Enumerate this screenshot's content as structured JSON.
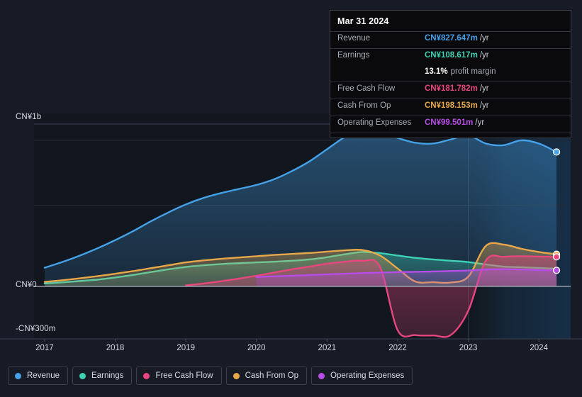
{
  "theme": {
    "background": "#161b26",
    "plot_background": "#12171f",
    "forecast_background": "#16283a",
    "gridline": "#252b36",
    "zero_line": "#aab2bd",
    "axis_text": "#d6dae2",
    "tooltip_bg": "#0a0a0c",
    "tooltip_border": "#3a3f4a"
  },
  "tooltip": {
    "date": "Mar 31 2024",
    "rows": [
      {
        "label": "Revenue",
        "value": "CN¥827.647m",
        "unit": "/yr",
        "color": "#45a1e8"
      },
      {
        "label": "Earnings",
        "value": "CN¥108.617m",
        "unit": "/yr",
        "color": "#3ed2b5"
      },
      {
        "label": "Free Cash Flow",
        "value": "CN¥181.782m",
        "unit": "/yr",
        "color": "#e8467e"
      },
      {
        "label": "Cash From Op",
        "value": "CN¥198.153m",
        "unit": "/yr",
        "color": "#e8a849"
      },
      {
        "label": "Operating Expenses",
        "value": "CN¥99.501m",
        "unit": "/yr",
        "color": "#b84ce8"
      }
    ],
    "margin": {
      "value": "13.1%",
      "text": "profit margin"
    }
  },
  "axes": {
    "y_labels": {
      "top": "CN¥1b",
      "zero": "CN¥0",
      "bottom": "-CN¥300m"
    },
    "y_ticks_values": [
      1000,
      0,
      -300
    ],
    "x_labels": [
      "2017",
      "2018",
      "2019",
      "2020",
      "2021",
      "2022",
      "2023",
      "2024"
    ]
  },
  "legend": {
    "items": [
      {
        "label": "Revenue",
        "color": "#45a1e8"
      },
      {
        "label": "Earnings",
        "color": "#3ed2b5"
      },
      {
        "label": "Free Cash Flow",
        "color": "#e8467e"
      },
      {
        "label": "Cash From Op",
        "color": "#e8a849"
      },
      {
        "label": "Operating Expenses",
        "color": "#b84ce8"
      }
    ]
  },
  "chart_data": {
    "type": "area",
    "title": "",
    "xlabel": "",
    "ylabel": "CN¥",
    "ylim": [
      -300,
      1050
    ],
    "xlim": [
      2016.85,
      2024.45
    ],
    "grid": true,
    "legend_position": "bottom",
    "currency": "CN¥",
    "units": "millions",
    "y_gridlines": [
      1000,
      900,
      500,
      0
    ],
    "forecast_start": 2023.0,
    "x": [
      2017.0,
      2017.25,
      2017.5,
      2017.75,
      2018.0,
      2018.25,
      2018.5,
      2018.75,
      2019.0,
      2019.25,
      2019.5,
      2019.75,
      2020.0,
      2020.25,
      2020.5,
      2020.75,
      2021.0,
      2021.25,
      2021.5,
      2021.75,
      2022.0,
      2022.25,
      2022.5,
      2022.75,
      2023.0,
      2023.25,
      2023.5,
      2023.75,
      2024.0,
      2024.25
    ],
    "series": [
      {
        "name": "Revenue",
        "color": "#45a1e8",
        "values": [
          115,
          150,
          190,
          235,
          285,
          340,
          400,
          455,
          505,
          545,
          575,
          600,
          625,
          660,
          710,
          770,
          845,
          920,
          975,
          960,
          915,
          885,
          880,
          905,
          930,
          880,
          870,
          900,
          880,
          828
        ]
      },
      {
        "name": "Earnings",
        "color": "#3ed2b5",
        "values": [
          18,
          25,
          33,
          42,
          55,
          70,
          88,
          105,
          120,
          130,
          138,
          143,
          148,
          152,
          158,
          166,
          180,
          198,
          212,
          205,
          190,
          176,
          166,
          158,
          150,
          135,
          122,
          118,
          114,
          109
        ]
      },
      {
        "name": "Free Cash Flow",
        "color": "#e8467e",
        "values": [
          null,
          null,
          null,
          null,
          null,
          null,
          null,
          null,
          6,
          18,
          32,
          48,
          66,
          85,
          105,
          122,
          140,
          152,
          158,
          120,
          -270,
          -300,
          -302,
          -300,
          -150,
          160,
          182,
          186,
          184,
          182
        ]
      },
      {
        "name": "Cash From Op",
        "color": "#e8a849",
        "values": [
          28,
          38,
          50,
          63,
          78,
          94,
          112,
          130,
          148,
          160,
          170,
          178,
          186,
          194,
          200,
          206,
          214,
          222,
          224,
          190,
          110,
          30,
          26,
          24,
          60,
          250,
          258,
          232,
          212,
          198
        ]
      },
      {
        "name": "Operating Expenses",
        "color": "#b84ce8",
        "values": [
          null,
          null,
          null,
          null,
          null,
          null,
          null,
          null,
          null,
          null,
          null,
          null,
          58,
          62,
          66,
          70,
          74,
          78,
          82,
          85,
          88,
          90,
          92,
          95,
          98,
          104,
          106,
          104,
          101,
          99
        ]
      }
    ],
    "end_markers": [
      {
        "name": "Revenue",
        "x": 2024.25,
        "y": 828,
        "color": "#45a1e8"
      },
      {
        "name": "Cash From Op",
        "x": 2024.25,
        "y": 198,
        "color": "#e8a849"
      },
      {
        "name": "Free Cash Flow",
        "x": 2024.25,
        "y": 182,
        "color": "#e8467e"
      },
      {
        "name": "Operating Expenses",
        "x": 2024.25,
        "y": 99,
        "color": "#b84ce8"
      }
    ]
  }
}
